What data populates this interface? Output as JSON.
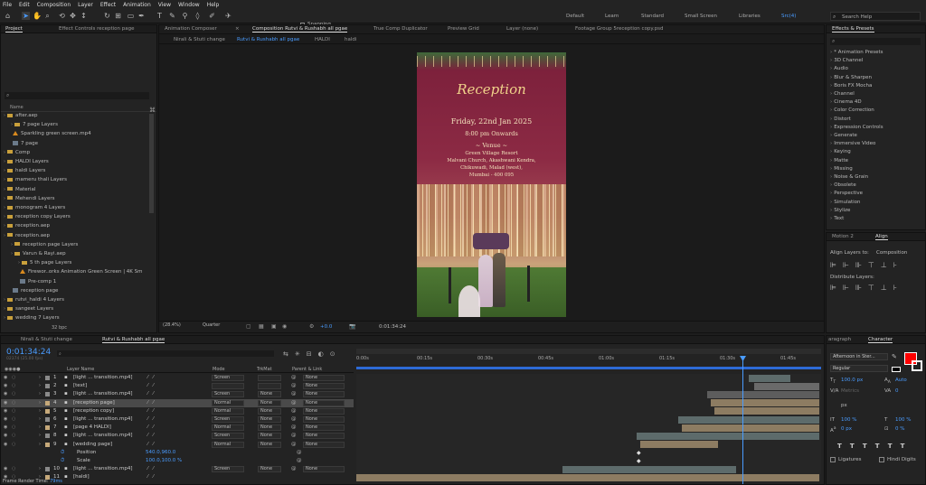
{
  "menu": [
    "File",
    "Edit",
    "Composition",
    "Layer",
    "Effect",
    "Animation",
    "View",
    "Window",
    "Help"
  ],
  "toolbar": {
    "snapping": "Snapping",
    "workspaces": [
      "Default",
      "Learn",
      "Standard",
      "Small Screen",
      "Libraries"
    ],
    "active_ws": "Src(4)",
    "search": "Search Help"
  },
  "project": {
    "tab1": "Project",
    "tab2": "Effect Controls reception page",
    "col_name": "Name",
    "search_icon": "search-icon",
    "tree": [
      {
        "indent": 0,
        "icon": "folder",
        "name": "after.aep"
      },
      {
        "indent": 1,
        "icon": "folder",
        "name": "7 page Layers"
      },
      {
        "indent": 1,
        "icon": "warn",
        "name": "Sparkling green screen.mp4"
      },
      {
        "indent": 1,
        "icon": "comp",
        "name": "7 page"
      },
      {
        "indent": 0,
        "icon": "folder",
        "name": "Comp"
      },
      {
        "indent": 0,
        "icon": "folder",
        "name": "HALDI Layers"
      },
      {
        "indent": 0,
        "icon": "folder",
        "name": "haldi Layers"
      },
      {
        "indent": 0,
        "icon": "folder",
        "name": "mameru thali Layers"
      },
      {
        "indent": 0,
        "icon": "folder",
        "name": "Material"
      },
      {
        "indent": 0,
        "icon": "folder",
        "name": "Mehendi Layers"
      },
      {
        "indent": 0,
        "icon": "folder",
        "name": "monogram 4 Layers"
      },
      {
        "indent": 0,
        "icon": "folder",
        "name": "reception copy Layers"
      },
      {
        "indent": 0,
        "icon": "folder",
        "name": "reception.aep"
      },
      {
        "indent": 0,
        "icon": "folder",
        "name": "reception.aep"
      },
      {
        "indent": 1,
        "icon": "folder",
        "name": "reception page Layers"
      },
      {
        "indent": 1,
        "icon": "folder",
        "name": "Varun & Rayi.aep"
      },
      {
        "indent": 2,
        "icon": "folder",
        "name": "5 th page Layers"
      },
      {
        "indent": 2,
        "icon": "warn",
        "name": "Firewor..orks Animation Green Screen | 4K Sm"
      },
      {
        "indent": 2,
        "icon": "comp",
        "name": "Pre-comp 1"
      },
      {
        "indent": 1,
        "icon": "comp",
        "name": "reception page"
      },
      {
        "indent": 0,
        "icon": "folder",
        "name": "rutvi_haldi 4 Layers"
      },
      {
        "indent": 0,
        "icon": "folder",
        "name": "sangeet Layers"
      },
      {
        "indent": 0,
        "icon": "folder",
        "name": "wedding 7 Layers"
      }
    ],
    "bpc": "32 bpc"
  },
  "viewer": {
    "tabs_top": [
      "Animation Composer",
      "Composition Rutvi & Rushabh all pgae",
      "True Comp Duplicator",
      "Preview Grid",
      "Layer (none)",
      "Footage Group 5reception copy.psd"
    ],
    "tabs_sub": [
      "Nirali & Stuti change",
      "Rutvi & Rushabh all pgae",
      "HALDI",
      "haldi"
    ],
    "zoom": "(28.4%)",
    "quality": "Quarter",
    "time": "0:01:34:24",
    "exposure": "+0.0"
  },
  "card": {
    "title": "Reception",
    "date": "Friday, 22nd Jan 2025",
    "time": "8:00 pm Onwards",
    "venue_h": "~ Venue ~",
    "venue": "Green Village Resort",
    "addr1": "Malvani Church, Akashwani Kendra,",
    "addr2": "Chikuwadi, Malad (west),",
    "addr3": "Mumbai - 400 095"
  },
  "effects": {
    "tab": "Effects & Presets",
    "search": "⌕",
    "items": [
      "* Animation Presets",
      "3D Channel",
      "Audio",
      "Blur & Sharpen",
      "Boris FX Mocha",
      "Channel",
      "Cinema 4D",
      "Color Correction",
      "Distort",
      "Expression Controls",
      "Generate",
      "Immersive Video",
      "Keying",
      "Matte",
      "Missing",
      "Noise & Grain",
      "Obsolete",
      "Perspective",
      "Simulation",
      "Stylize",
      "Text"
    ]
  },
  "align": {
    "tab1": "Motion 2",
    "tab2": "Align",
    "align_to_lbl": "Align Layers to:",
    "align_to": "Composition",
    "distribute": "Distribute Layers:"
  },
  "timeline": {
    "tab1": "Nirali & Stuti change",
    "tab2": "Rutvi & Rushabh all pgae",
    "timecode": "0:01:34:24",
    "fps": "02374 (25.00 fps)",
    "headers": {
      "name": "Layer Name",
      "mode": "Mode",
      "trkmat": "TrkMat",
      "parent": "Parent & Link"
    },
    "ruler": [
      "0:00s",
      "00:15s",
      "00:30s",
      "00:45s",
      "01:00s",
      "01:15s",
      "01:30s",
      "01:45s"
    ],
    "layers": [
      {
        "n": "1",
        "name": "[light ... transition.mp4]",
        "mode": "Screen",
        "trk": "",
        "parent": "None",
        "color": "#8a8a8a"
      },
      {
        "n": "2",
        "name": "[text]",
        "mode": "",
        "trk": "",
        "parent": "None",
        "color": "#8a8a8a"
      },
      {
        "n": "3",
        "name": "[light ... transition.mp4]",
        "mode": "Screen",
        "trk": "None",
        "parent": "None",
        "color": "#8a8a8a"
      },
      {
        "n": "4",
        "name": "[reception page]",
        "mode": "Normal",
        "trk": "None",
        "parent": "None",
        "color": "#c6a97a"
      },
      {
        "n": "5",
        "name": "[reception copy]",
        "mode": "Normal",
        "trk": "None",
        "parent": "None",
        "color": "#c6a97a"
      },
      {
        "n": "6",
        "name": "[light ... transition.mp4]",
        "mode": "Screen",
        "trk": "None",
        "parent": "None",
        "color": "#8a8a8a"
      },
      {
        "n": "7",
        "name": "[page 4 HALDI]",
        "mode": "Normal",
        "trk": "None",
        "parent": "None",
        "color": "#c6a97a"
      },
      {
        "n": "8",
        "name": "[light ... transition.mp4]",
        "mode": "Screen",
        "trk": "None",
        "parent": "None",
        "color": "#8a8a8a"
      },
      {
        "n": "9",
        "name": "[wedding page]",
        "mode": "Normal",
        "trk": "None",
        "parent": "None",
        "color": "#c6a97a"
      }
    ],
    "props": [
      {
        "name": "Position",
        "value": "540.0,960.0"
      },
      {
        "name": "Scale",
        "value": "100.0,100.0 %"
      }
    ],
    "layer10": {
      "n": "10",
      "name": "[light ... transition.mp4]",
      "mode": "Screen",
      "trk": "None",
      "parent": "None"
    },
    "layer11": {
      "n": "11",
      "name": "[haldi]"
    },
    "render": "Frame Render Time:",
    "render_val": "79ms"
  },
  "character": {
    "tab1": "aragraph",
    "tab2": "Character",
    "font": "Afternoon in Ster...",
    "style": "Regular",
    "size": "100.0 px",
    "leading": "Auto",
    "tracking": "0",
    "kerning": "Metrics",
    "unit": "px",
    "vscale": "100 %",
    "hscale": "100 %",
    "baseline": "0 px",
    "tsume": "0 %",
    "ligatures": "Ligatures",
    "hindi": "Hindi Digits",
    "fill_color": "#ff0000"
  }
}
